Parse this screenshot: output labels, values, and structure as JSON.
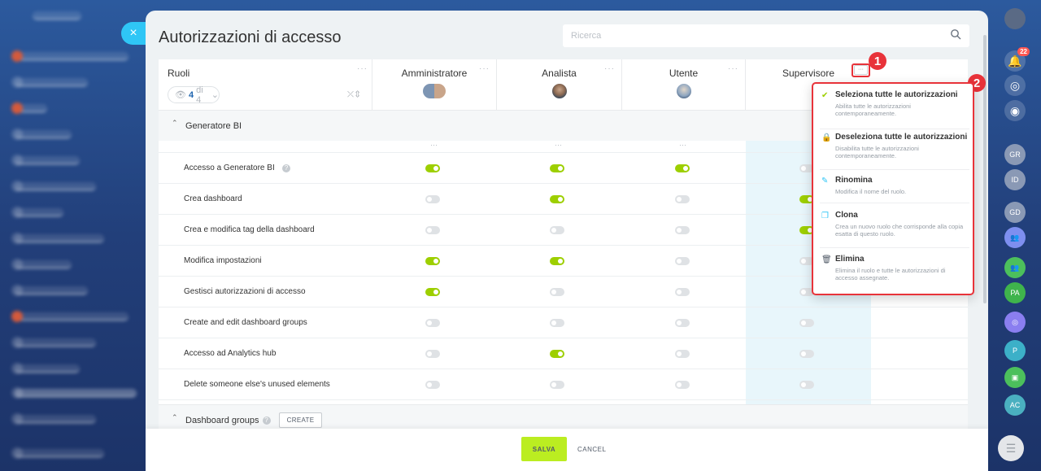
{
  "panel": {
    "title": "Autorizzazioni di accesso",
    "search_placeholder": "Ricerca",
    "close_label": "×"
  },
  "table": {
    "roles_header": "Ruoli",
    "counter_icon": "eye-icon",
    "counter_value": "4",
    "counter_suffix": "di 4",
    "columns": [
      {
        "label": "Amministratore"
      },
      {
        "label": "Analista"
      },
      {
        "label": "Utente"
      },
      {
        "label": "Supervisore"
      }
    ],
    "sections": [
      {
        "title": "Generatore BI"
      },
      {
        "title": "Dashboard groups",
        "create_label": "CREATE"
      }
    ],
    "rows": [
      {
        "label": "Accesso a Generatore BI",
        "values": [
          true,
          true,
          true,
          false
        ]
      },
      {
        "label": "Crea dashboard",
        "values": [
          false,
          true,
          false,
          true
        ]
      },
      {
        "label": "Crea e modifica tag della dashboard",
        "values": [
          false,
          false,
          false,
          true
        ]
      },
      {
        "label": "Modifica impostazioni",
        "values": [
          true,
          true,
          false,
          false
        ]
      },
      {
        "label": "Gestisci autorizzazioni di accesso",
        "values": [
          true,
          false,
          false,
          false
        ]
      },
      {
        "label": "Create and edit dashboard groups",
        "values": [
          false,
          false,
          false,
          false
        ]
      },
      {
        "label": "Accesso ad Analytics hub",
        "values": [
          false,
          true,
          false,
          false
        ]
      },
      {
        "label": "Delete someone else's unused elements",
        "values": [
          false,
          false,
          false,
          false
        ]
      }
    ]
  },
  "markers": [
    "1",
    "2"
  ],
  "popup": {
    "items": [
      {
        "title": "Seleziona tutte le autorizzazioni",
        "desc": "Abilita tutte le autorizzazioni contemporaneamente.",
        "icon": "check-icon"
      },
      {
        "title": "Deseleziona tutte le autorizzazioni",
        "desc": "Disabilita tutte le autorizzazioni contemporaneamente.",
        "icon": "lock-icon"
      },
      {
        "title": "Rinomina",
        "desc": "Modifica il nome del ruolo.",
        "icon": "pencil-icon"
      },
      {
        "title": "Clona",
        "desc": "Crea un nuovo ruolo che corrisponde alla copia esatta di questo ruolo.",
        "icon": "copy-icon"
      },
      {
        "title": "Elimina",
        "desc": "Elimina il ruolo e tutte le autorizzazioni di accesso assegnate.",
        "icon": "trash-icon"
      }
    ]
  },
  "footer": {
    "save_label": "SALVA",
    "cancel_label": "CANCEL"
  },
  "right_bar": {
    "notifications_count": "22",
    "avatars": [
      "GR",
      "ID",
      "GD",
      "PA",
      "P",
      "AC"
    ]
  },
  "colors": {
    "toggle_on": "#9dcf00",
    "save": "#bbed21",
    "accent": "#2fc6f6",
    "highlight": "#e8333a"
  }
}
